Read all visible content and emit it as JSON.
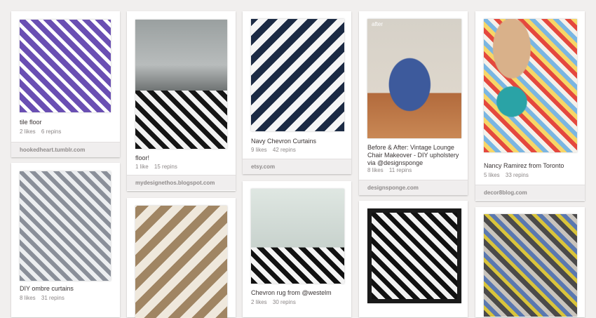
{
  "pins": [
    {
      "id": "p1",
      "description": "tile floor",
      "likes": "2 likes",
      "repins": "6 repins",
      "source": "hookedheart.tumblr.com"
    },
    {
      "id": "p2",
      "description": "floor!",
      "likes": "1 like",
      "repins": "15 repins",
      "source": "mydesignethos.blogspot.com"
    },
    {
      "id": "p3",
      "description": "Navy Chevron Curtains",
      "likes": "9 likes",
      "repins": "42 repins",
      "source": "etsy.com"
    },
    {
      "id": "p4",
      "description": "Before & After: Vintage Lounge Chair Makeover - DIY upholstery via @designsponge",
      "likes": "8 likes",
      "repins": "11 repins",
      "source": "designsponge.com"
    },
    {
      "id": "p5",
      "description": "Nancy Ramirez from Toronto",
      "likes": "5 likes",
      "repins": "33 repins",
      "source": "decor8blog.com"
    },
    {
      "id": "p6",
      "description": "DIY ombre curtains",
      "likes": "8 likes",
      "repins": "31 repins"
    },
    {
      "id": "p8",
      "description": "Chevron rug from @westelm",
      "likes": "2 likes",
      "repins": "30 repins"
    }
  ],
  "labels": {
    "after": "after"
  }
}
